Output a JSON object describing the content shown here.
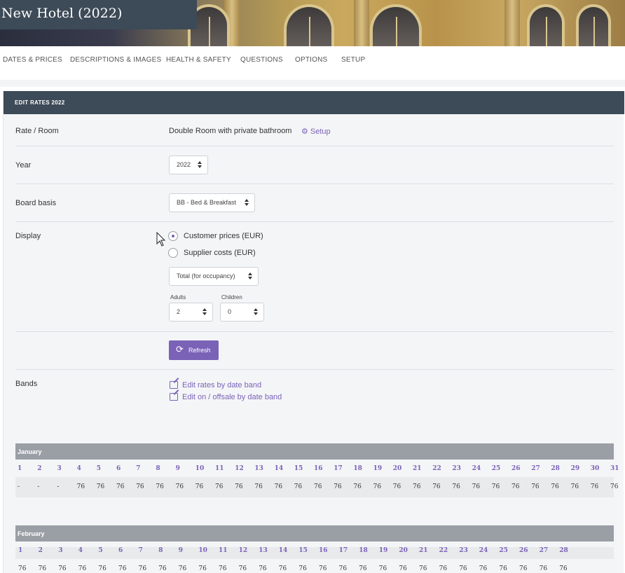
{
  "header": {
    "title": "New Hotel (2022)"
  },
  "nav": {
    "items": [
      {
        "label": "DATES & PRICES",
        "name": "nav-dates-prices"
      },
      {
        "label": "DESCRIPTIONS & IMAGES",
        "name": "nav-descriptions-images"
      },
      {
        "label": "HEALTH & SAFETY",
        "name": "nav-health-safety"
      },
      {
        "label": "QUESTIONS",
        "name": "nav-questions"
      },
      {
        "label": "OPTIONS",
        "name": "nav-options"
      },
      {
        "label": "SETUP",
        "name": "nav-setup"
      }
    ]
  },
  "panel": {
    "title": "EDIT RATES 2022",
    "rate_room": {
      "label": "Rate / Room",
      "value": "Double Room with private bathroom",
      "setup_link": "Setup",
      "icon": "gear-icon"
    },
    "year": {
      "label": "Year",
      "value": "2022"
    },
    "board_basis": {
      "label": "Board basis",
      "value": "BB - Bed & Breakfast"
    },
    "display": {
      "label": "Display",
      "option_customer": "Customer prices (EUR)",
      "option_supplier": "Supplier costs (EUR)",
      "selected": "Customer prices (EUR)",
      "mode_value": "Total (for occupancy)",
      "adults_label": "Adults",
      "adults_value": "2",
      "children_label": "Children",
      "children_value": "0"
    },
    "refresh_label": "Refresh",
    "bands": {
      "label": "Bands",
      "link_rates": "Edit rates by date band",
      "link_onoff": "Edit on / offsale by date band"
    }
  },
  "calendar": {
    "january": {
      "name": "January",
      "days": [
        "1",
        "2",
        "3",
        "4",
        "5",
        "6",
        "7",
        "8",
        "9",
        "10",
        "11",
        "12",
        "13",
        "14",
        "15",
        "16",
        "17",
        "18",
        "19",
        "20",
        "21",
        "22",
        "23",
        "24",
        "25",
        "26",
        "27",
        "28",
        "29",
        "30",
        "31"
      ],
      "values": [
        "-",
        "-",
        "-",
        "76",
        "76",
        "76",
        "76",
        "76",
        "76",
        "76",
        "76",
        "76",
        "76",
        "76",
        "76",
        "76",
        "76",
        "76",
        "76",
        "76",
        "76",
        "76",
        "76",
        "76",
        "76",
        "76",
        "76",
        "76",
        "76",
        "76",
        "76"
      ]
    },
    "february": {
      "name": "February",
      "days": [
        "1",
        "2",
        "3",
        "4",
        "5",
        "6",
        "7",
        "8",
        "9",
        "10",
        "11",
        "12",
        "13",
        "14",
        "15",
        "16",
        "17",
        "18",
        "19",
        "20",
        "21",
        "22",
        "23",
        "24",
        "25",
        "26",
        "27",
        "28"
      ],
      "values": [
        "76",
        "76",
        "76",
        "76",
        "76",
        "76",
        "76",
        "76",
        "76",
        "76",
        "76",
        "76",
        "76",
        "76",
        "76",
        "76",
        "76",
        "76",
        "76",
        "76",
        "76",
        "76",
        "76",
        "76",
        "76",
        "76",
        "76",
        "76"
      ]
    }
  },
  "colors": {
    "accent": "#7a62b7",
    "header_dark": "#3d4a57",
    "month_bar": "#9a9ea5"
  }
}
